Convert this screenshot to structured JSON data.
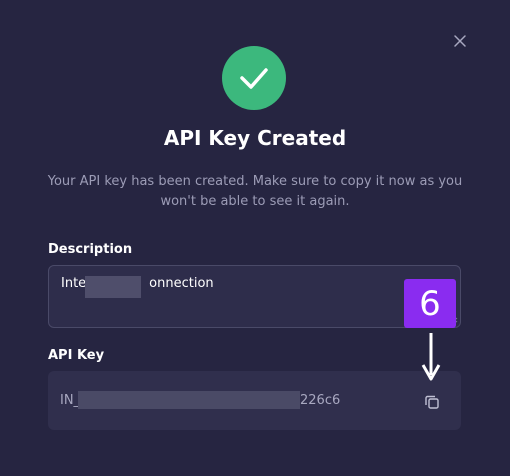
{
  "dialog": {
    "title": "API Key Created",
    "subtitle": "Your API key has been created. Make sure to copy it now as you won't be able to see it again."
  },
  "description": {
    "label": "Description",
    "value_start": "Inte",
    "value_end": "onnection"
  },
  "api_key": {
    "label": "API Key",
    "value_start": "IN_",
    "value_end": "226c6"
  },
  "annotation": {
    "badge_number": "6",
    "badge_color": "#8a2cf0"
  },
  "icons": {
    "close": "close-icon",
    "success": "checkmark-icon",
    "copy": "copy-icon"
  },
  "colors": {
    "background": "#262541",
    "success": "#3cb87d",
    "text_muted": "#9c9cb6"
  }
}
